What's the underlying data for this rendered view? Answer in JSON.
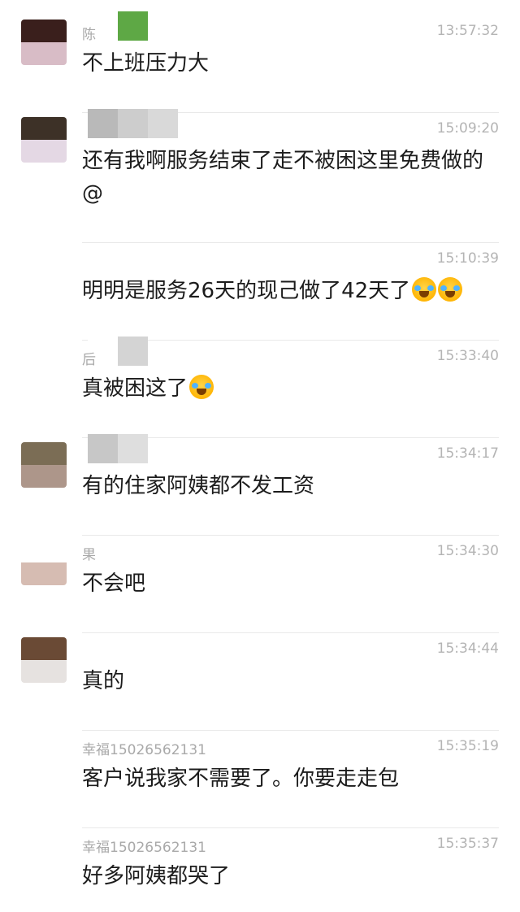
{
  "messages": [
    {
      "name": "陈",
      "time": "13:57:32",
      "text": "不上班压力大",
      "emoji_count": 0,
      "avatar": {
        "top": "#3a1f1c",
        "bottom": "#d8bcc6"
      },
      "blur": [
        "#ffffff",
        "#5ea845"
      ]
    },
    {
      "name": "",
      "time": "15:09:20",
      "text": "还有我啊服务结束了走不被困这里免费做的@",
      "emoji_count": 0,
      "avatar": {
        "top": "#3d3127",
        "bottom": "#e4d8e4"
      },
      "blur": [
        "#b9b9b9",
        "#cdcdcd",
        "#d9d9d9"
      ]
    },
    {
      "name": "",
      "time": "15:10:39",
      "text": "明明是服务26天的现己做了42天了",
      "emoji_count": 2,
      "avatar": null,
      "blur": []
    },
    {
      "name": "后",
      "time": "15:33:40",
      "text": "真被困这了",
      "emoji_count": 1,
      "avatar": null,
      "blur": [
        "#ffffff",
        "#d4d4d4"
      ]
    },
    {
      "name": "",
      "time": "15:34:17",
      "text": "有的住家阿姨都不发工资",
      "emoji_count": 0,
      "avatar": {
        "top": "#7b6d55",
        "bottom": "#ad968a"
      },
      "blur": [
        "#c7c7c7",
        "#dedede"
      ]
    },
    {
      "name": "果",
      "time": "15:34:30",
      "text": "不会吧",
      "emoji_count": 0,
      "avatar": {
        "top": "#ffffff",
        "bottom": "#d6bcb2"
      },
      "blur": []
    },
    {
      "name": "",
      "time": "15:34:44",
      "text": "真的",
      "emoji_count": 0,
      "avatar": {
        "top": "#6a4a35",
        "bottom": "#e6e2e0"
      },
      "blur": []
    },
    {
      "name": "幸福15026562131",
      "time": "15:35:19",
      "text": "客户说我家不需要了。你要走走包",
      "emoji_count": 0,
      "avatar": null,
      "blur": []
    },
    {
      "name": "幸福15026562131",
      "time": "15:35:37",
      "text": "好多阿姨都哭了",
      "emoji_count": 0,
      "avatar": null,
      "blur": []
    }
  ],
  "icons": {
    "emoji": "face-with-tears-of-joy-icon"
  }
}
